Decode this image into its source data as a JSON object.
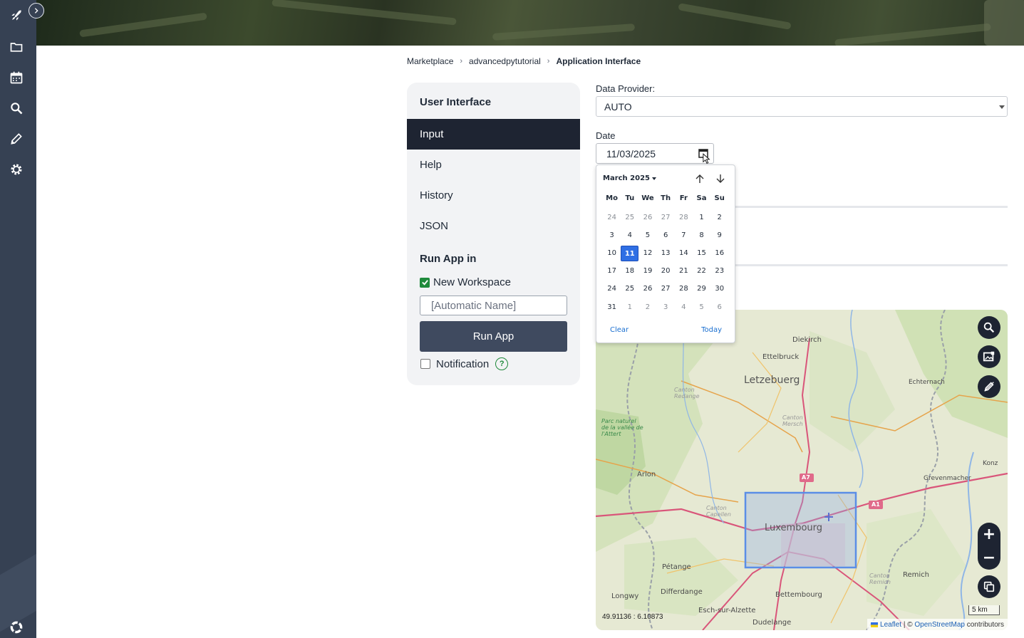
{
  "breadcrumb": {
    "items": [
      "Marketplace",
      "advancedpytutorial"
    ],
    "current": "Application Interface",
    "separator": "›"
  },
  "panel": {
    "title": "User Interface",
    "nav": [
      "Input",
      "Help",
      "History",
      "JSON"
    ],
    "active_nav": "Input",
    "run_title": "Run App in",
    "new_workspace_label": "New Workspace",
    "new_workspace_checked": true,
    "name_placeholder": "[Automatic Name]",
    "run_button": "Run App",
    "notification_label": "Notification",
    "notification_checked": false,
    "help_glyph": "?"
  },
  "form": {
    "provider_label": "Data Provider:",
    "provider_value": "AUTO",
    "date_label": "Date",
    "date_value": "11/03/2025"
  },
  "datepicker": {
    "month_label": "March 2025",
    "weekdays": [
      "Mo",
      "Tu",
      "We",
      "Th",
      "Fr",
      "Sa",
      "Su"
    ],
    "weeks": [
      [
        "24",
        "25",
        "26",
        "27",
        "28",
        "1",
        "2"
      ],
      [
        "3",
        "4",
        "5",
        "6",
        "7",
        "8",
        "9"
      ],
      [
        "10",
        "11",
        "12",
        "13",
        "14",
        "15",
        "16"
      ],
      [
        "17",
        "18",
        "19",
        "20",
        "21",
        "22",
        "23"
      ],
      [
        "24",
        "25",
        "26",
        "27",
        "28",
        "29",
        "30"
      ],
      [
        "31",
        "1",
        "2",
        "3",
        "4",
        "5",
        "6"
      ]
    ],
    "selected_day": "11",
    "clear_label": "Clear",
    "today_label": "Today"
  },
  "map": {
    "places": [
      {
        "name": "Diekirch",
        "style": "small"
      },
      {
        "name": "Ettelbruck",
        "style": "small"
      },
      {
        "name": "Letzebuerg",
        "style": "large"
      },
      {
        "name": "Echternach",
        "style": "small"
      },
      {
        "name": "Canton Redange",
        "style": "canton"
      },
      {
        "name": "Canton Mersch",
        "style": "canton"
      },
      {
        "name": "Parc naturel de la vallée de l'Attert",
        "style": "park"
      },
      {
        "name": "Arlon",
        "style": "small"
      },
      {
        "name": "Grevenmacher",
        "style": "small"
      },
      {
        "name": "Konz",
        "style": "small"
      },
      {
        "name": "Canton Capellen",
        "style": "canton"
      },
      {
        "name": "Luxembourg",
        "style": "large"
      },
      {
        "name": "Canton Remich",
        "style": "canton"
      },
      {
        "name": "Pétange",
        "style": "small"
      },
      {
        "name": "Remich",
        "style": "small"
      },
      {
        "name": "Differdange",
        "style": "small"
      },
      {
        "name": "Longwy",
        "style": "small"
      },
      {
        "name": "Bettembourg",
        "style": "small"
      },
      {
        "name": "Esch-sur-Alzette",
        "style": "small"
      },
      {
        "name": "Dudelange",
        "style": "small"
      }
    ],
    "road_labels": [
      "A7",
      "A1"
    ],
    "coords_text": "49.91136 : 6.10873",
    "scale_text": "5 km",
    "attribution": {
      "leaflet": "Leaflet",
      "separator": " | © ",
      "osm": "OpenStreetMap",
      "suffix": " contributors"
    },
    "zoom_in": "+",
    "zoom_out": "−"
  },
  "icons": {
    "rail": [
      "rocket-icon",
      "folder-icon",
      "calendar-icon",
      "search-icon",
      "pencil-icon",
      "gear-icon",
      "lifebuoy-icon"
    ],
    "map_controls": [
      "search-icon",
      "image-export-icon",
      "draw-icon",
      "layers-icon"
    ]
  },
  "colors": {
    "rail": "#364153",
    "active_nav": "#1e2432",
    "run_button": "#3f4a5f",
    "checkbox": "#1f8a3b",
    "selected_day": "#2f6fe4",
    "link": "#1a6fd0"
  }
}
